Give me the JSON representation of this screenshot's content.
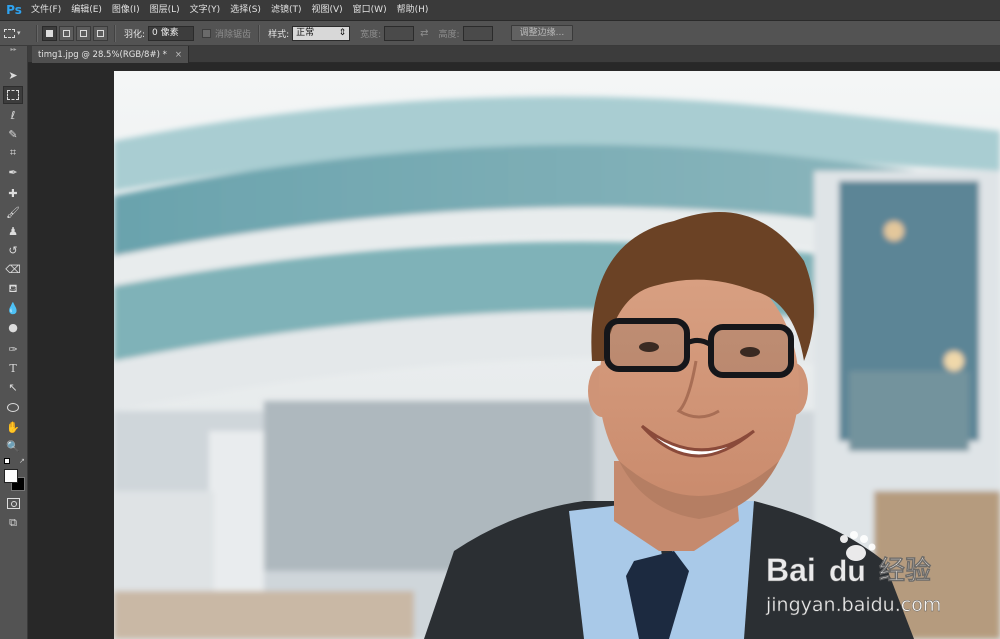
{
  "app": {
    "logo": "Ps"
  },
  "menu": [
    "文件(F)",
    "编辑(E)",
    "图像(I)",
    "图层(L)",
    "文字(Y)",
    "选择(S)",
    "滤镜(T)",
    "视图(V)",
    "窗口(W)",
    "帮助(H)"
  ],
  "options": {
    "feather_label": "羽化:",
    "feather_value": "0 像素",
    "antialias_label": "消除锯齿",
    "style_label": "样式:",
    "style_value": "正常",
    "width_label": "宽度:",
    "height_label": "高度:",
    "refine_edge_button": "调整边缘..."
  },
  "document": {
    "tab_title": "timg1.jpg @ 28.5%(RGB/8#) *",
    "close": "×"
  },
  "watermark": {
    "brand_a": "Bai",
    "brand_b": "du",
    "brand_c": "经验",
    "url": "jingyan.baidu.com"
  },
  "colors": {
    "accent": "#2fa3f0",
    "panel": "#535353",
    "workspace": "#282828"
  }
}
